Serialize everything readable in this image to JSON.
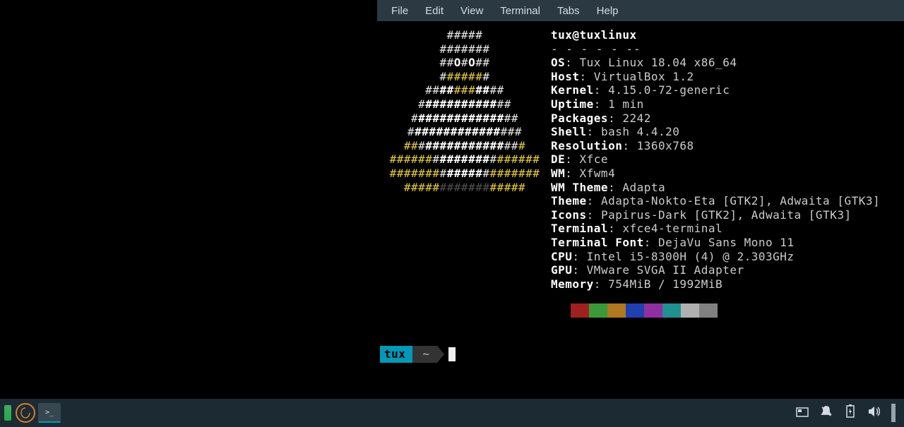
{
  "menubar": {
    "items": [
      "File",
      "Edit",
      "View",
      "Terminal",
      "Tabs",
      "Help"
    ]
  },
  "neofetch": {
    "ascii": [
      {
        "segments": [
          {
            "t": "#####",
            "c": "white"
          }
        ]
      },
      {
        "segments": [
          {
            "t": "#######",
            "c": "white"
          }
        ]
      },
      {
        "segments": [
          {
            "t": "##",
            "c": "white"
          },
          {
            "t": "O",
            "c": "bold"
          },
          {
            "t": "#",
            "c": "white"
          },
          {
            "t": "O",
            "c": "bold"
          },
          {
            "t": "##",
            "c": "white"
          }
        ]
      },
      {
        "segments": [
          {
            "t": "#",
            "c": "white"
          },
          {
            "t": "#####",
            "c": "yellow"
          },
          {
            "t": "#",
            "c": "white"
          }
        ]
      },
      {
        "segments": [
          {
            "t": "##",
            "c": "white"
          },
          {
            "t": "##",
            "c": "bold"
          },
          {
            "t": "###",
            "c": "yellow"
          },
          {
            "t": "##",
            "c": "bold"
          },
          {
            "t": "##",
            "c": "white"
          }
        ]
      },
      {
        "segments": [
          {
            "t": "#",
            "c": "white"
          },
          {
            "t": "##########",
            "c": "bold"
          },
          {
            "t": "##",
            "c": "white"
          }
        ]
      },
      {
        "segments": [
          {
            "t": "#",
            "c": "white"
          },
          {
            "t": "############",
            "c": "bold"
          },
          {
            "t": "##",
            "c": "white"
          }
        ]
      },
      {
        "segments": [
          {
            "t": "#",
            "c": "white"
          },
          {
            "t": "############",
            "c": "bold"
          },
          {
            "t": "###",
            "c": "white"
          }
        ]
      },
      {
        "segments": [
          {
            "t": "##",
            "c": "yellow"
          },
          {
            "t": "#",
            "c": "white"
          },
          {
            "t": "###########",
            "c": "bold"
          },
          {
            "t": "##",
            "c": "white"
          },
          {
            "t": "#",
            "c": "yellow"
          }
        ]
      },
      {
        "segments": [
          {
            "t": "######",
            "c": "yellow"
          },
          {
            "t": "#",
            "c": "white"
          },
          {
            "t": "#######",
            "c": "bold"
          },
          {
            "t": "#",
            "c": "white"
          },
          {
            "t": "######",
            "c": "yellow"
          }
        ]
      },
      {
        "segments": [
          {
            "t": "#######",
            "c": "yellow"
          },
          {
            "t": "#",
            "c": "white"
          },
          {
            "t": "#####",
            "c": "bold"
          },
          {
            "t": "#",
            "c": "white"
          },
          {
            "t": "#######",
            "c": "yellow"
          }
        ]
      },
      {
        "segments": [
          {
            "t": "#####",
            "c": "yellow"
          },
          {
            "t": "#######",
            "c": "dim"
          },
          {
            "t": "#####",
            "c": "yellow"
          }
        ]
      }
    ],
    "title": "tux@tuxlinux",
    "info": [
      {
        "label": "OS",
        "value": "Tux Linux 18.04 x86_64"
      },
      {
        "label": "Host",
        "value": "VirtualBox 1.2"
      },
      {
        "label": "Kernel",
        "value": "4.15.0-72-generic"
      },
      {
        "label": "Uptime",
        "value": "1 min"
      },
      {
        "label": "Packages",
        "value": "2242"
      },
      {
        "label": "Shell",
        "value": "bash 4.4.20"
      },
      {
        "label": "Resolution",
        "value": "1360x768"
      },
      {
        "label": "DE",
        "value": "Xfce"
      },
      {
        "label": "WM",
        "value": "Xfwm4"
      },
      {
        "label": "WM Theme",
        "value": "Adapta"
      },
      {
        "label": "Theme",
        "value": "Adapta-Nokto-Eta [GTK2], Adwaita [GTK3]"
      },
      {
        "label": "Icons",
        "value": "Papirus-Dark [GTK2], Adwaita [GTK3]"
      },
      {
        "label": "Terminal",
        "value": "xfce4-terminal"
      },
      {
        "label": "Terminal Font",
        "value": "DejaVu Sans Mono 11"
      },
      {
        "label": "CPU",
        "value": "Intel i5-8300H (4) @ 2.303GHz"
      },
      {
        "label": "GPU",
        "value": "VMware SVGA II Adapter"
      },
      {
        "label": "Memory",
        "value": "754MiB / 1992MiB"
      }
    ],
    "colors": [
      "#a02020",
      "#3a9a3a",
      "#b07820",
      "#2040b0",
      "#9030a0",
      "#209090",
      "#b0b0b0",
      "#808080"
    ]
  },
  "prompt": {
    "user": "tux",
    "path": "~"
  },
  "taskbar": {
    "tray": [
      "workspace-icon",
      "notifications-icon",
      "power-icon",
      "volume-icon"
    ]
  }
}
